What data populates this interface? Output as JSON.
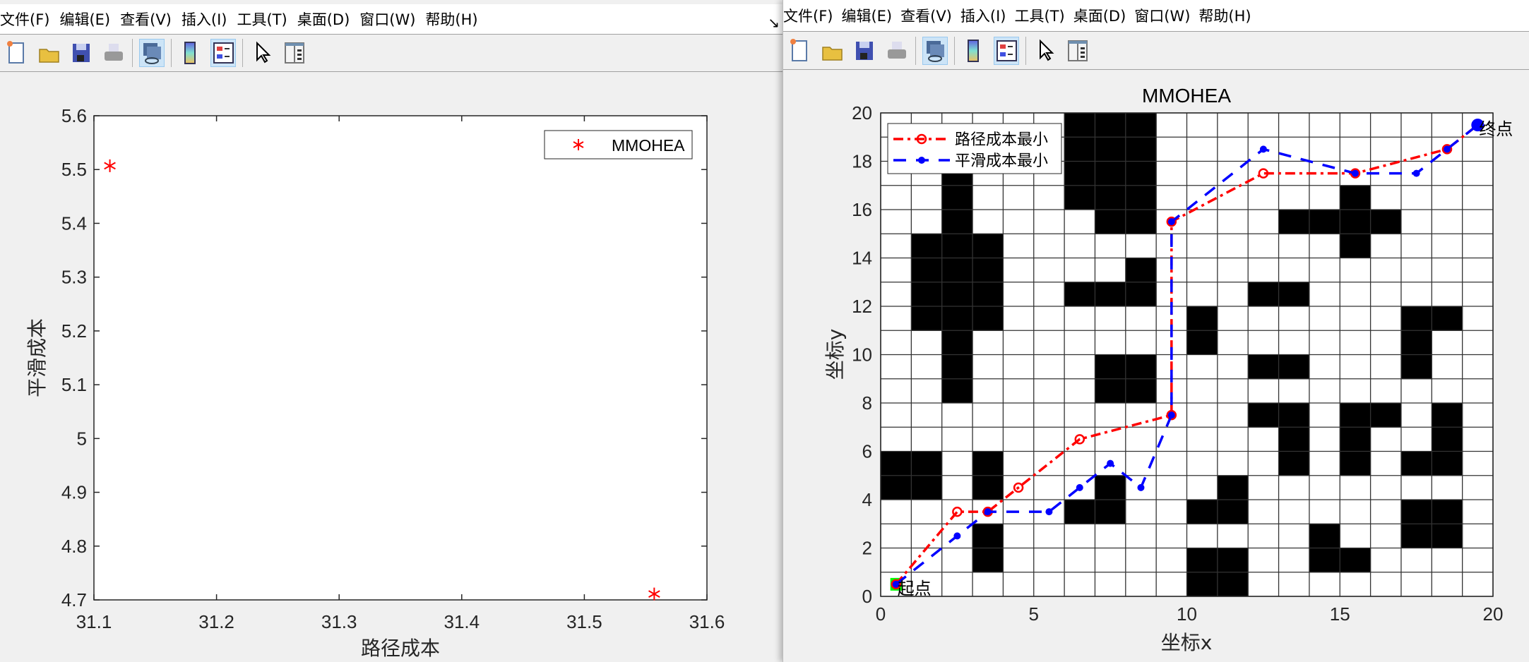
{
  "left_window": {
    "menu": [
      "文件(F)",
      "编辑(E)",
      "查看(V)",
      "插入(I)",
      "工具(T)",
      "桌面(D)",
      "窗口(W)",
      "帮助(H)"
    ],
    "restore_icon": "↘",
    "toolbar": [
      "new-figure",
      "open-file",
      "save",
      "print",
      "link",
      "colorbar",
      "legend",
      "pointer",
      "property-inspector"
    ]
  },
  "right_window": {
    "menu": [
      "文件(F)",
      "编辑(E)",
      "查看(V)",
      "插入(I)",
      "工具(T)",
      "桌面(D)",
      "窗口(W)",
      "帮助(H)"
    ],
    "toolbar": [
      "new-figure",
      "open-file",
      "save",
      "print",
      "link",
      "colorbar",
      "legend",
      "pointer",
      "property-inspector"
    ]
  },
  "chart_data": [
    {
      "type": "scatter",
      "title": "",
      "xlabel": "路径成本",
      "ylabel": "平滑成本",
      "xlim": [
        31.1,
        31.6
      ],
      "ylim": [
        4.7,
        5.6
      ],
      "xticks": [
        "31.1",
        "31.2",
        "31.3",
        "31.4",
        "31.5",
        "31.6"
      ],
      "yticks": [
        "4.7",
        "4.8",
        "4.9",
        "5",
        "5.1",
        "5.2",
        "5.3",
        "5.4",
        "5.5",
        "5.6"
      ],
      "legend": {
        "entries": [
          "MMOHEA"
        ],
        "placement": "top-right"
      },
      "series": [
        {
          "name": "MMOHEA",
          "marker": "*",
          "color": "#ff0000",
          "points": [
            [
              31.113,
              5.507
            ],
            [
              31.557,
              4.711
            ]
          ]
        }
      ]
    },
    {
      "type": "line",
      "title": "MMOHEA",
      "xlabel": "坐标x",
      "ylabel": "坐标y",
      "xlim": [
        0,
        20
      ],
      "ylim": [
        0,
        20
      ],
      "xticks": [
        "0",
        "5",
        "10",
        "15",
        "20"
      ],
      "yticks": [
        "0",
        "2",
        "4",
        "6",
        "8",
        "10",
        "12",
        "14",
        "16",
        "18",
        "20"
      ],
      "grid": true,
      "legend": {
        "entries": [
          "路径成本最小",
          "平滑成本最小"
        ],
        "placement": "top-left"
      },
      "start_label": "起点",
      "end_label": "终点",
      "obstacles": [
        [
          6,
          19
        ],
        [
          7,
          19
        ],
        [
          8,
          19
        ],
        [
          6,
          18
        ],
        [
          7,
          18
        ],
        [
          8,
          18
        ],
        [
          6,
          17
        ],
        [
          7,
          17
        ],
        [
          8,
          17
        ],
        [
          6,
          16
        ],
        [
          7,
          16
        ],
        [
          8,
          16
        ],
        [
          7,
          15
        ],
        [
          8,
          15
        ],
        [
          2,
          17
        ],
        [
          2,
          16
        ],
        [
          2,
          15
        ],
        [
          1,
          14
        ],
        [
          2,
          14
        ],
        [
          3,
          14
        ],
        [
          1,
          13
        ],
        [
          2,
          13
        ],
        [
          3,
          13
        ],
        [
          1,
          12
        ],
        [
          2,
          12
        ],
        [
          3,
          12
        ],
        [
          1,
          11
        ],
        [
          2,
          11
        ],
        [
          3,
          11
        ],
        [
          2,
          10
        ],
        [
          2,
          9
        ],
        [
          2,
          8
        ],
        [
          8,
          13
        ],
        [
          6,
          12
        ],
        [
          7,
          12
        ],
        [
          8,
          12
        ],
        [
          10,
          11
        ],
        [
          10,
          10
        ],
        [
          12,
          12
        ],
        [
          13,
          12
        ],
        [
          15,
          16
        ],
        [
          13,
          15
        ],
        [
          14,
          15
        ],
        [
          15,
          15
        ],
        [
          16,
          15
        ],
        [
          15,
          14
        ],
        [
          17,
          11
        ],
        [
          18,
          11
        ],
        [
          17,
          10
        ],
        [
          17,
          9
        ],
        [
          12,
          9
        ],
        [
          13,
          9
        ],
        [
          7,
          9
        ],
        [
          8,
          9
        ],
        [
          7,
          8
        ],
        [
          8,
          8
        ],
        [
          12,
          7
        ],
        [
          13,
          7
        ],
        [
          13,
          6
        ],
        [
          13,
          5
        ],
        [
          15,
          7
        ],
        [
          16,
          7
        ],
        [
          15,
          6
        ],
        [
          15,
          5
        ],
        [
          18,
          7
        ],
        [
          18,
          6
        ],
        [
          17,
          5
        ],
        [
          18,
          5
        ],
        [
          0,
          5
        ],
        [
          1,
          5
        ],
        [
          0,
          4
        ],
        [
          1,
          4
        ],
        [
          3,
          5
        ],
        [
          3,
          4
        ],
        [
          7,
          4
        ],
        [
          6,
          3
        ],
        [
          7,
          3
        ],
        [
          11,
          4
        ],
        [
          10,
          3
        ],
        [
          11,
          3
        ],
        [
          17,
          3
        ],
        [
          18,
          3
        ],
        [
          17,
          2
        ],
        [
          18,
          2
        ],
        [
          3,
          2
        ],
        [
          3,
          1
        ],
        [
          14,
          2
        ],
        [
          14,
          1
        ],
        [
          15,
          1
        ],
        [
          10,
          1
        ],
        [
          11,
          1
        ],
        [
          10,
          0
        ],
        [
          11,
          0
        ]
      ],
      "series": [
        {
          "name": "路径成本最小",
          "color": "#ff0000",
          "style": "dash-dot",
          "marker": "o",
          "x": [
            0.5,
            2.5,
            3.5,
            4.5,
            6.5,
            9.5,
            9.5,
            12.5,
            15.5,
            18.5,
            19.5
          ],
          "y": [
            0.5,
            3.5,
            3.5,
            4.5,
            6.5,
            7.5,
            15.5,
            17.5,
            17.5,
            18.5,
            19.5
          ]
        },
        {
          "name": "平滑成本最小",
          "color": "#0000ff",
          "style": "dashed",
          "marker": "filled-dot",
          "x": [
            0.5,
            2.5,
            3.5,
            5.5,
            6.5,
            7.5,
            8.5,
            9.5,
            9.5,
            12.5,
            15.5,
            17.5,
            18.5,
            19.5
          ],
          "y": [
            0.5,
            2.5,
            3.5,
            3.5,
            4.5,
            5.5,
            4.5,
            7.5,
            15.5,
            18.5,
            17.5,
            17.5,
            18.5,
            19.5
          ]
        }
      ],
      "start_color": "#00ff00"
    }
  ]
}
